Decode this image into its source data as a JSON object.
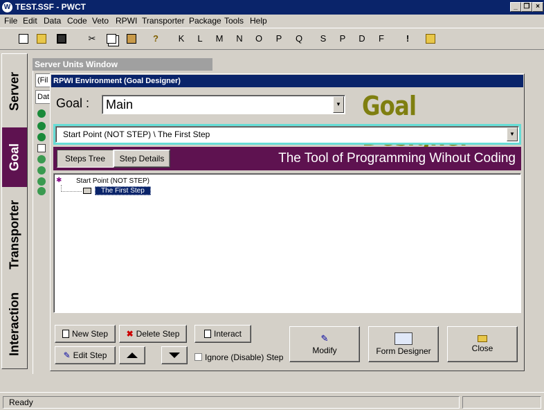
{
  "window": {
    "title": "TEST.SSF  - PWCT",
    "app_icon": "W"
  },
  "menu": [
    "File",
    "Edit",
    "Data",
    "Code",
    "Veto",
    "RPWI",
    "Transporter",
    "Package",
    "Tools",
    "Help"
  ],
  "toolbar": {
    "letters": [
      "K",
      "L",
      "M",
      "N",
      "O",
      "P",
      "Q",
      "S",
      "P",
      "D",
      "F",
      "!"
    ]
  },
  "left_tabs": {
    "server": "Server",
    "goal": "Goal",
    "transporter": "Transporter",
    "interaction": "Interaction"
  },
  "units_window": {
    "title": "Server Units Window",
    "box1": "(Fil",
    "box2": "Dat"
  },
  "dialog": {
    "title": "RPWI Environment (Goal Designer)",
    "goal_label": "Goal :",
    "goal_value": "Main",
    "brand": "Goal Designer",
    "path_value": "Start Point (NOT STEP)  \\  The First Step",
    "tabs": {
      "steps_tree": "Steps Tree",
      "step_details": "Step Details"
    },
    "tagline": "The Tool of Programming Wihout Coding",
    "tree": {
      "root": "Start Point (NOT STEP)",
      "child": "The First Step"
    },
    "buttons": {
      "new_step": "New Step",
      "delete_step": "Delete Step",
      "interact": "Interact",
      "edit_step": "Edit Step",
      "ignore_step": "Ignore (Disable) Step",
      "modify": "Modify",
      "form_designer": "Form Designer",
      "close": "Close"
    }
  },
  "status": {
    "text": "Ready"
  },
  "colors": {
    "titlebar": "#0a246a",
    "purple": "#5e1250",
    "brand": "#7f7f10",
    "cyan": "#66ddd6"
  }
}
